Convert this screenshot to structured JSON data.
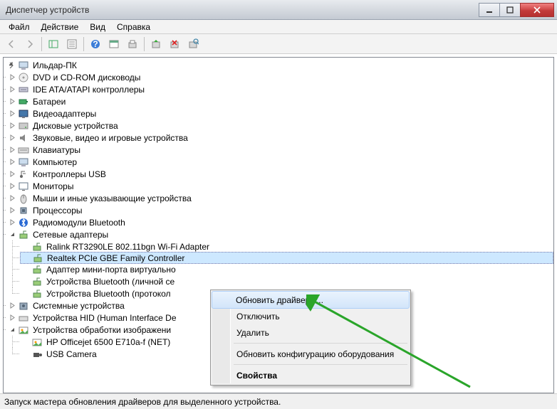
{
  "title": "Диспетчер устройств",
  "menubar": [
    "Файл",
    "Действие",
    "Вид",
    "Справка"
  ],
  "tree": {
    "root": "Ильдар-ПК",
    "cats": [
      {
        "label": "DVD и CD-ROM дисководы",
        "icon": "cd"
      },
      {
        "label": "IDE ATA/ATAPI контроллеры",
        "icon": "ide"
      },
      {
        "label": "Батареи",
        "icon": "battery"
      },
      {
        "label": "Видеоадаптеры",
        "icon": "display"
      },
      {
        "label": "Дисковые устройства",
        "icon": "hdd"
      },
      {
        "label": "Звуковые, видео и игровые устройства",
        "icon": "sound"
      },
      {
        "label": "Клавиатуры",
        "icon": "keyboard"
      },
      {
        "label": "Компьютер",
        "icon": "computer"
      },
      {
        "label": "Контроллеры USB",
        "icon": "usb"
      },
      {
        "label": "Мониторы",
        "icon": "monitor"
      },
      {
        "label": "Мыши и иные указывающие устройства",
        "icon": "mouse"
      },
      {
        "label": "Процессоры",
        "icon": "cpu"
      },
      {
        "label": "Радиомодули Bluetooth",
        "icon": "bt"
      }
    ],
    "net": {
      "label": "Сетевые адаптеры",
      "items": [
        "Ralink RT3290LE 802.11bgn Wi-Fi Adapter",
        "Realtek PCIe GBE Family Controller",
        "Адаптер мини-порта виртуально",
        "Устройства Bluetooth (личной се",
        "Устройства Bluetooth (протокол"
      ]
    },
    "tail": [
      {
        "label": "Системные устройства",
        "icon": "sys"
      },
      {
        "label": "Устройства HID (Human Interface De",
        "icon": "hid"
      }
    ],
    "imaging": {
      "label": "Устройства обработки изображени",
      "items": [
        "HP Officejet 6500 E710a-f (NET)",
        "USB Camera"
      ]
    }
  },
  "context": {
    "items": [
      "Обновить драйверы...",
      "Отключить",
      "Удалить",
      "Обновить конфигурацию оборудования",
      "Свойства"
    ]
  },
  "status": "Запуск мастера обновления драйверов для выделенного устройства."
}
